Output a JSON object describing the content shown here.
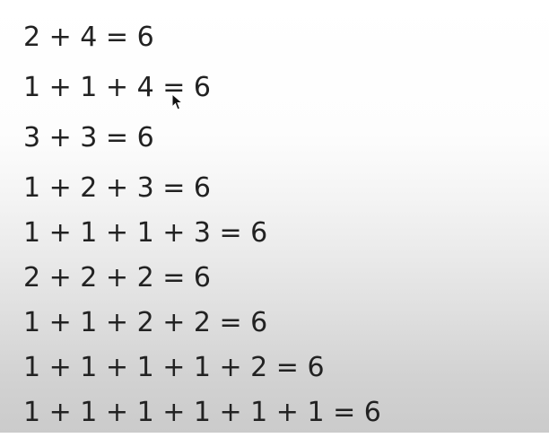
{
  "equations": [
    "2 + 4 = 6",
    "1 + 1 + 4 = 6",
    "3 + 3 = 6",
    "1 + 2 + 3 = 6",
    "1 + 1 + 1 + 3 = 6",
    "2 + 2 + 2 = 6",
    "1 + 1 + 2 + 2 = 6",
    "1 + 1 + 1 + 1 + 2 = 6",
    "1 + 1 + 1 + 1 + 1 + 1 = 6"
  ],
  "text_color": "#222222",
  "cursor_icon": "mouse-pointer-icon"
}
